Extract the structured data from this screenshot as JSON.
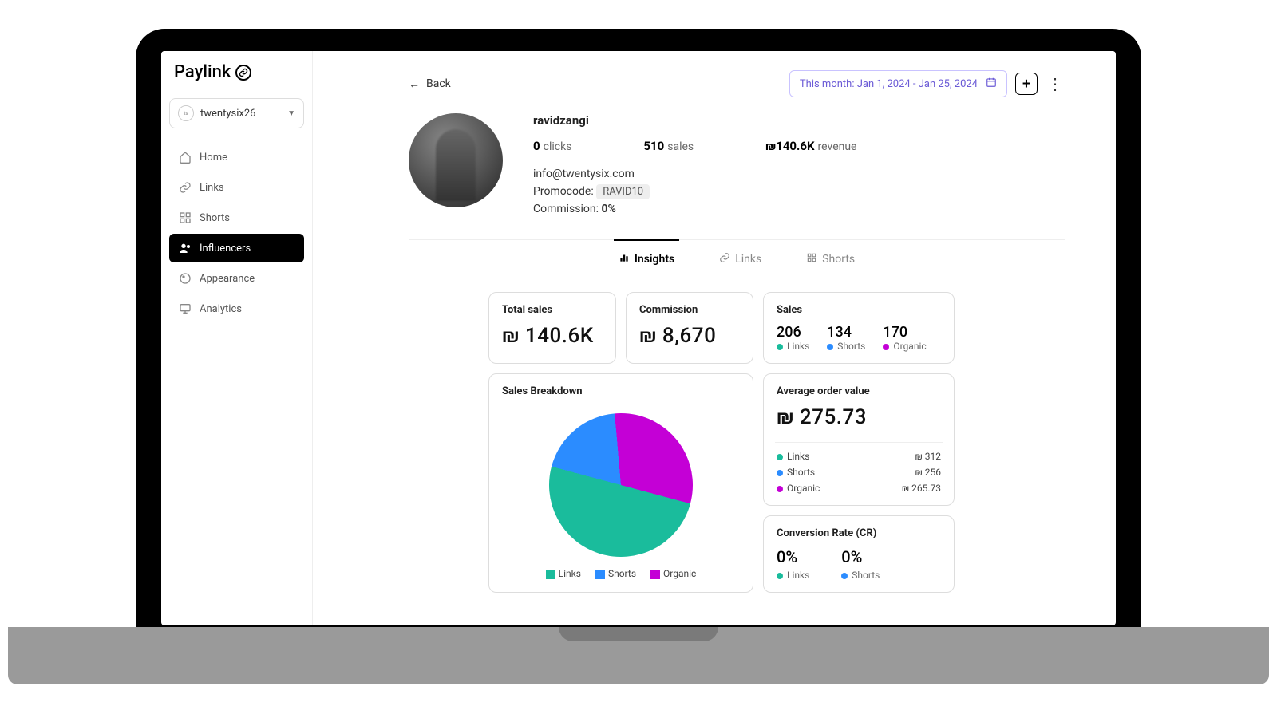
{
  "brand": "Paylink",
  "workspace": "twentysix26",
  "sidebar": {
    "items": [
      {
        "label": "Home"
      },
      {
        "label": "Links"
      },
      {
        "label": "Shorts"
      },
      {
        "label": "Influencers"
      },
      {
        "label": "Appearance"
      },
      {
        "label": "Analytics"
      }
    ],
    "activeIndex": 3
  },
  "topbar": {
    "back": "Back",
    "date_range": "This month: Jan 1, 2024 - Jan 25, 2024"
  },
  "profile": {
    "username": "ravidzangi",
    "clicks_value": "0",
    "clicks_label": "clicks",
    "sales_value": "510",
    "sales_label": "sales",
    "revenue_value": "₪140.6K",
    "revenue_label": "revenue",
    "email": "info@twentysix.com",
    "promocode_label": "Promocode:",
    "promocode": "RAVID10",
    "commission_label": "Commission:",
    "commission_value": "0%"
  },
  "tabs": [
    {
      "label": "Insights"
    },
    {
      "label": "Links"
    },
    {
      "label": "Shorts"
    }
  ],
  "cards": {
    "total_sales": {
      "title": "Total sales",
      "value": "₪ 140.6K"
    },
    "commission": {
      "title": "Commission",
      "value": "₪ 8,670"
    },
    "sales": {
      "title": "Sales",
      "links": {
        "value": "206",
        "label": "Links"
      },
      "shorts": {
        "value": "134",
        "label": "Shorts"
      },
      "organic": {
        "value": "170",
        "label": "Organic"
      }
    },
    "breakdown": {
      "title": "Sales Breakdown",
      "legend": {
        "links": "Links",
        "shorts": "Shorts",
        "organic": "Organic"
      }
    },
    "aov": {
      "title": "Average order value",
      "value": "₪ 275.73",
      "rows": [
        {
          "label": "Links",
          "value": "₪ 312"
        },
        {
          "label": "Shorts",
          "value": "₪ 256"
        },
        {
          "label": "Organic",
          "value": "₪ 265.73"
        }
      ]
    },
    "cr": {
      "title": "Conversion Rate (CR)",
      "links": {
        "pct": "0%",
        "label": "Links"
      },
      "shorts": {
        "pct": "0%",
        "label": "Shorts"
      }
    }
  },
  "chart_data": {
    "type": "pie",
    "title": "Sales Breakdown",
    "series": [
      {
        "name": "Links",
        "value": 206,
        "color": "#1abc9c"
      },
      {
        "name": "Shorts",
        "value": 134,
        "color": "#2b8cff"
      },
      {
        "name": "Organic",
        "value": 170,
        "color": "#c400d6"
      }
    ]
  }
}
